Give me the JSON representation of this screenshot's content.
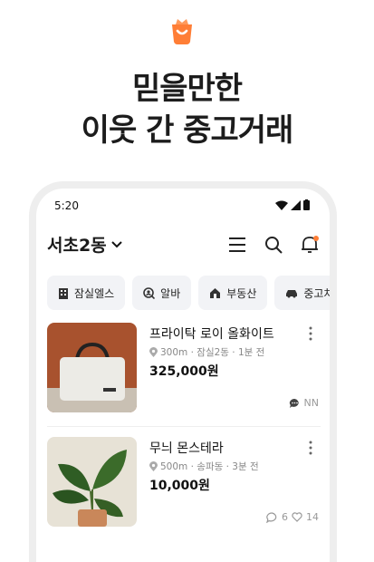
{
  "headline": {
    "line1": "믿을만한",
    "line2": "이웃 간 중고거래"
  },
  "colors": {
    "brand": "#ff7e36",
    "text": "#1c1c1c",
    "muted": "#888888"
  },
  "phone": {
    "status_time": "5:20",
    "location": "서초2동",
    "chips": [
      {
        "label": "잠실엘스",
        "icon": "building-icon"
      },
      {
        "label": "알바",
        "icon": "search-person-icon"
      },
      {
        "label": "부동산",
        "icon": "house-icon"
      },
      {
        "label": "중고차",
        "icon": "car-icon"
      }
    ],
    "items": [
      {
        "title": "프라이탁 로이 올화이트",
        "meta": "300m · 잠실2동 · 1분 전",
        "price": "325,000원",
        "chat_count": "NN"
      },
      {
        "title": "무늬 몬스테라",
        "meta": "500m · 송파동 · 3분 전",
        "price": "10,000원",
        "chat_count": "6",
        "like_count": "14"
      }
    ]
  }
}
